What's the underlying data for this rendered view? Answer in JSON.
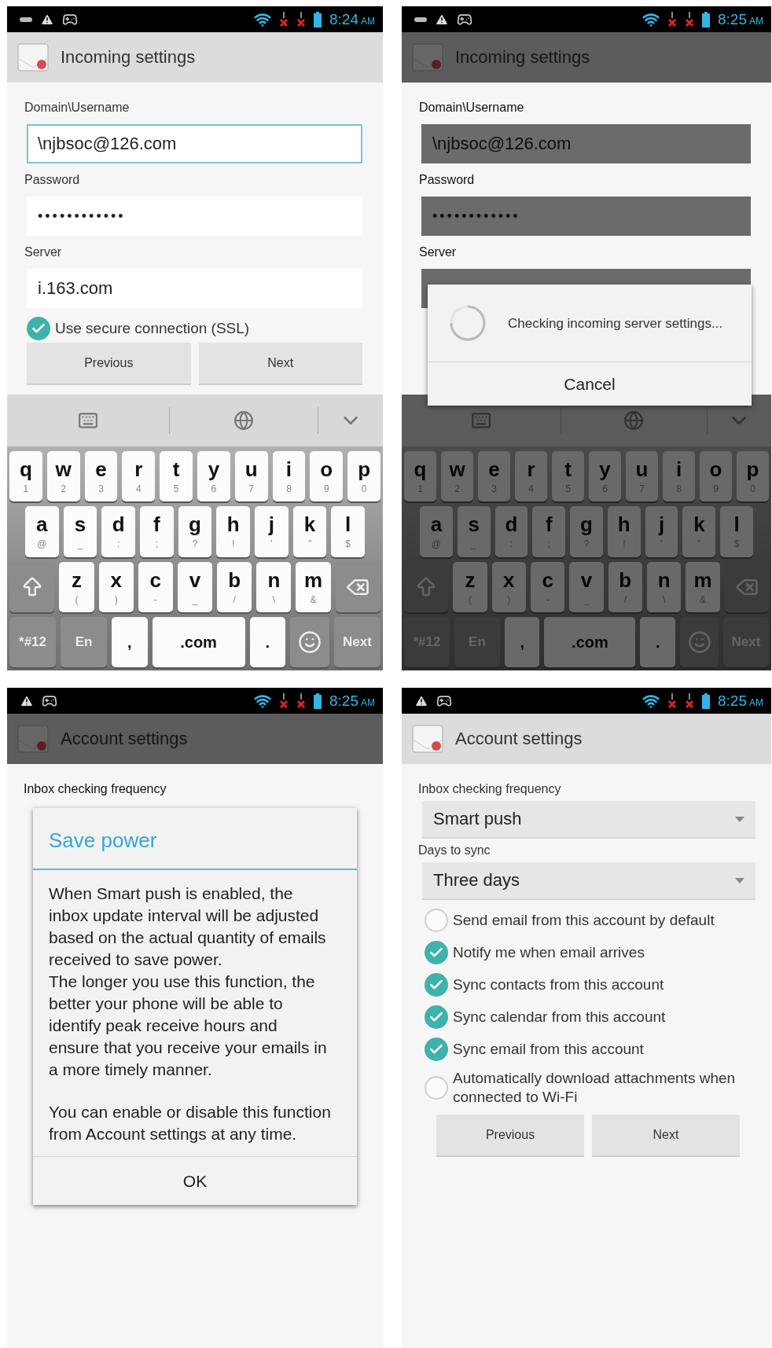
{
  "phones": [
    {
      "status": {
        "extra_notification": true,
        "time": "8:24",
        "period": "AM"
      },
      "dimmed": false,
      "appbar": {
        "title": "Incoming settings"
      },
      "screen": {
        "kind": "incoming",
        "fields": [
          {
            "label": "Domain\\Username",
            "value": "\\njbsoc@126.com",
            "kind": "text",
            "focused": true
          },
          {
            "label": "Password",
            "value": "••••••••••••",
            "kind": "password",
            "focused": false
          },
          {
            "label": "Server",
            "value": "i.163.com",
            "kind": "text",
            "focused": false
          }
        ],
        "ssl": {
          "label": "Use secure connection (SSL)",
          "checked": true
        },
        "buttons": [
          "Previous",
          "Next"
        ],
        "keyboard": {
          "rows": [
            {
              "keys": [
                {
                  "kind": "letter",
                  "key": "q",
                  "sub": "1"
                },
                {
                  "kind": "letter",
                  "key": "w",
                  "sub": "2"
                },
                {
                  "kind": "letter",
                  "key": "e",
                  "sub": "3"
                },
                {
                  "kind": "letter",
                  "key": "r",
                  "sub": "4"
                },
                {
                  "kind": "letter",
                  "key": "t",
                  "sub": "5"
                },
                {
                  "kind": "letter",
                  "key": "y",
                  "sub": "6"
                },
                {
                  "kind": "letter",
                  "key": "u",
                  "sub": "7"
                },
                {
                  "kind": "letter",
                  "key": "i",
                  "sub": "8"
                },
                {
                  "kind": "letter",
                  "key": "o",
                  "sub": "9"
                },
                {
                  "kind": "letter",
                  "key": "p",
                  "sub": "0"
                }
              ]
            },
            {
              "keys": [
                {
                  "kind": "letter",
                  "key": "a",
                  "sub": "@"
                },
                {
                  "kind": "letter",
                  "key": "s",
                  "sub": "_"
                },
                {
                  "kind": "letter",
                  "key": "d",
                  "sub": ":"
                },
                {
                  "kind": "letter",
                  "key": "f",
                  "sub": ";"
                },
                {
                  "kind": "letter",
                  "key": "g",
                  "sub": "?"
                },
                {
                  "kind": "letter",
                  "key": "h",
                  "sub": "!"
                },
                {
                  "kind": "letter",
                  "key": "j",
                  "sub": "'"
                },
                {
                  "kind": "letter",
                  "key": "k",
                  "sub": "\""
                },
                {
                  "kind": "letter",
                  "key": "l",
                  "sub": "$"
                }
              ]
            },
            {
              "keys": [
                {
                  "kind": "shift"
                },
                {
                  "kind": "letter",
                  "key": "z",
                  "sub": "("
                },
                {
                  "kind": "letter",
                  "key": "x",
                  "sub": ")"
                },
                {
                  "kind": "letter",
                  "key": "c",
                  "sub": "-"
                },
                {
                  "kind": "letter",
                  "key": "v",
                  "sub": "_"
                },
                {
                  "kind": "letter",
                  "key": "b",
                  "sub": "/"
                },
                {
                  "kind": "letter",
                  "key": "n",
                  "sub": "\\"
                },
                {
                  "kind": "letter",
                  "key": "m",
                  "sub": "&"
                },
                {
                  "kind": "backspace"
                }
              ]
            },
            {
              "keys": [
                {
                  "kind": "function",
                  "key": "*#12"
                },
                {
                  "kind": "function",
                  "key": "En"
                },
                {
                  "kind": "symbol",
                  "key": ","
                },
                {
                  "kind": "wide",
                  "key": ".com"
                },
                {
                  "kind": "symbol",
                  "key": "."
                },
                {
                  "kind": "emoji"
                },
                {
                  "kind": "function",
                  "key": "Next"
                }
              ]
            }
          ]
        }
      }
    },
    {
      "status": {
        "extra_notification": true,
        "time": "8:25",
        "period": "AM"
      },
      "dimmed": true,
      "appbar": {
        "title": "Incoming settings"
      },
      "screen": {
        "kind": "incoming",
        "fields": [
          {
            "label": "Domain\\Username",
            "value": "\\njbsoc@126.com",
            "kind": "text",
            "focused": false
          },
          {
            "label": "Password",
            "value": "••••••••••••",
            "kind": "password",
            "focused": false
          },
          {
            "label": "Server",
            "kind": "text",
            "focused": false
          }
        ],
        "keyboard": {
          "rows": [
            {
              "keys": [
                {
                  "kind": "letter",
                  "key": "q",
                  "sub": "1"
                },
                {
                  "kind": "letter",
                  "key": "w",
                  "sub": "2"
                },
                {
                  "kind": "letter",
                  "key": "e",
                  "sub": "3"
                },
                {
                  "kind": "letter",
                  "key": "r",
                  "sub": "4"
                },
                {
                  "kind": "letter",
                  "key": "t",
                  "sub": "5"
                },
                {
                  "kind": "letter",
                  "key": "y",
                  "sub": "6"
                },
                {
                  "kind": "letter",
                  "key": "u",
                  "sub": "7"
                },
                {
                  "kind": "letter",
                  "key": "i",
                  "sub": "8"
                },
                {
                  "kind": "letter",
                  "key": "o",
                  "sub": "9"
                },
                {
                  "kind": "letter",
                  "key": "p",
                  "sub": "0"
                }
              ]
            },
            {
              "keys": [
                {
                  "kind": "letter",
                  "key": "a",
                  "sub": "@"
                },
                {
                  "kind": "letter",
                  "key": "s",
                  "sub": "_"
                },
                {
                  "kind": "letter",
                  "key": "d",
                  "sub": ":"
                },
                {
                  "kind": "letter",
                  "key": "f",
                  "sub": ";"
                },
                {
                  "kind": "letter",
                  "key": "g",
                  "sub": "?"
                },
                {
                  "kind": "letter",
                  "key": "h",
                  "sub": "!"
                },
                {
                  "kind": "letter",
                  "key": "j",
                  "sub": "'"
                },
                {
                  "kind": "letter",
                  "key": "k",
                  "sub": "\""
                },
                {
                  "kind": "letter",
                  "key": "l",
                  "sub": "$"
                }
              ]
            },
            {
              "keys": [
                {
                  "kind": "shift"
                },
                {
                  "kind": "letter",
                  "key": "z",
                  "sub": "("
                },
                {
                  "kind": "letter",
                  "key": "x",
                  "sub": ")"
                },
                {
                  "kind": "letter",
                  "key": "c",
                  "sub": "-"
                },
                {
                  "kind": "letter",
                  "key": "v",
                  "sub": "_"
                },
                {
                  "kind": "letter",
                  "key": "b",
                  "sub": "/"
                },
                {
                  "kind": "letter",
                  "key": "n",
                  "sub": "\\"
                },
                {
                  "kind": "letter",
                  "key": "m",
                  "sub": "&"
                },
                {
                  "kind": "backspace"
                }
              ]
            },
            {
              "keys": [
                {
                  "kind": "function",
                  "key": "*#12"
                },
                {
                  "kind": "function",
                  "key": "En"
                },
                {
                  "kind": "symbol",
                  "key": ","
                },
                {
                  "kind": "wide",
                  "key": ".com"
                },
                {
                  "kind": "symbol",
                  "key": "."
                },
                {
                  "kind": "emoji"
                },
                {
                  "kind": "function",
                  "key": "Next"
                }
              ]
            }
          ]
        }
      },
      "dialog": {
        "kind": "progress",
        "message": "Checking incoming server settings...",
        "button": "Cancel"
      }
    },
    {
      "status": {
        "extra_notification": false,
        "time": "8:25",
        "period": "AM"
      },
      "dimmed": true,
      "appbar": {
        "title": "Account settings"
      },
      "screen": {
        "kind": "account",
        "selects": [
          {
            "label": "Inbox checking frequency"
          }
        ]
      },
      "dialog": {
        "kind": "alert",
        "title": "Save power",
        "paragraphs": [
          "When Smart push is enabled, the inbox update interval will be adjusted based on the actual quantity of emails received to save power.\nThe longer you use this function, the better your phone will be able to identify peak receive hours and ensure that you receive your emails in a more timely manner.",
          "You can enable or disable this function from Account settings at any time."
        ],
        "button": "OK"
      }
    },
    {
      "status": {
        "extra_notification": false,
        "time": "8:25",
        "period": "AM"
      },
      "dimmed": false,
      "appbar": {
        "title": "Account settings"
      },
      "screen": {
        "kind": "account",
        "selects": [
          {
            "label": "Inbox checking frequency",
            "value": "Smart push"
          },
          {
            "label": "Days to sync",
            "value": "Three days"
          }
        ],
        "options": [
          {
            "label": "Send email from this account by default",
            "checked": false
          },
          {
            "label": "Notify me when email arrives",
            "checked": true
          },
          {
            "label": "Sync contacts from this account",
            "checked": true
          },
          {
            "label": "Sync calendar from this account",
            "checked": true
          },
          {
            "label": "Sync email from this account",
            "checked": true
          },
          {
            "label": "Automatically download attachments when connected to Wi-Fi",
            "checked": false
          }
        ],
        "buttons": [
          "Previous",
          "Next"
        ]
      }
    }
  ]
}
